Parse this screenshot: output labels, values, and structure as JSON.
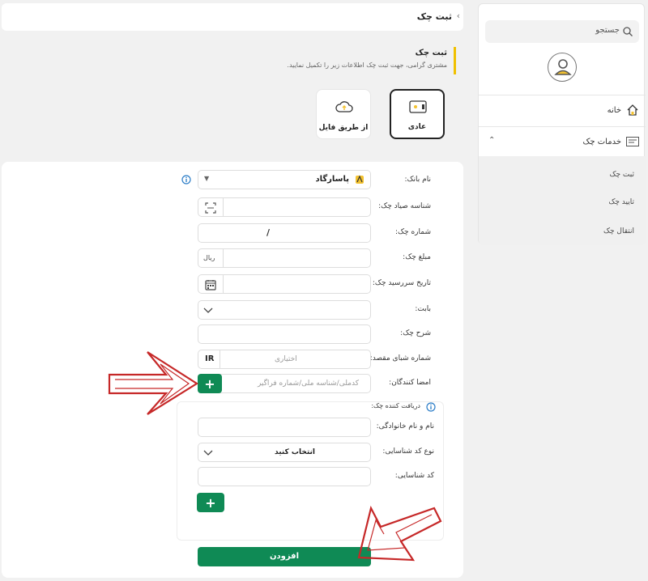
{
  "sidebar": {
    "search_placeholder": "جستجو",
    "home_label": "خانه",
    "cheque_services_label": "خدمات چک",
    "sub_items": [
      "ثبت چک",
      "تایید چک",
      "انتقال چک"
    ]
  },
  "topbar": {
    "title": "ثبت چک"
  },
  "heading": {
    "title": "ثبت چک",
    "subtitle": "مشتری گرامی، جهت ثبت چک اطلاعات زیر را تکمیل نمایید."
  },
  "options": {
    "regular_label": "عادی",
    "file_label": "از طریق فایل"
  },
  "form": {
    "bank_label": "نام بانک:",
    "bank_value": "پاسارگاد",
    "sayad_label": "شناسه صیاد چک:",
    "cheque_number_label": "شماره چک:",
    "slash": "/",
    "amount_label": "مبلغ چک:",
    "currency": "ریال",
    "due_date_label": "تاریخ سررسید چک:",
    "reason_label": "بابت:",
    "description_label": "شرح چک:",
    "sheba_label": "شماره شبای مقصد:",
    "sheba_prefix": "IR",
    "sheba_placeholder": "اختیاری",
    "signers_label": "امضا کنندگان:",
    "signers_placeholder": "کدملی/شناسه ملی/شماره فراگیر",
    "receiver_title": "دریافت کننده چک:",
    "name_label": "نام و نام خانوادگی:",
    "id_type_label": "نوع کد شناسایی:",
    "id_type_value": "انتخاب کنید",
    "id_code_label": "کد شناسایی:",
    "submit_label": "افزودن"
  },
  "colors": {
    "accent_green": "#0f8a55",
    "highlight_yellow": "#f0c000",
    "arrow_red": "#c62828"
  }
}
